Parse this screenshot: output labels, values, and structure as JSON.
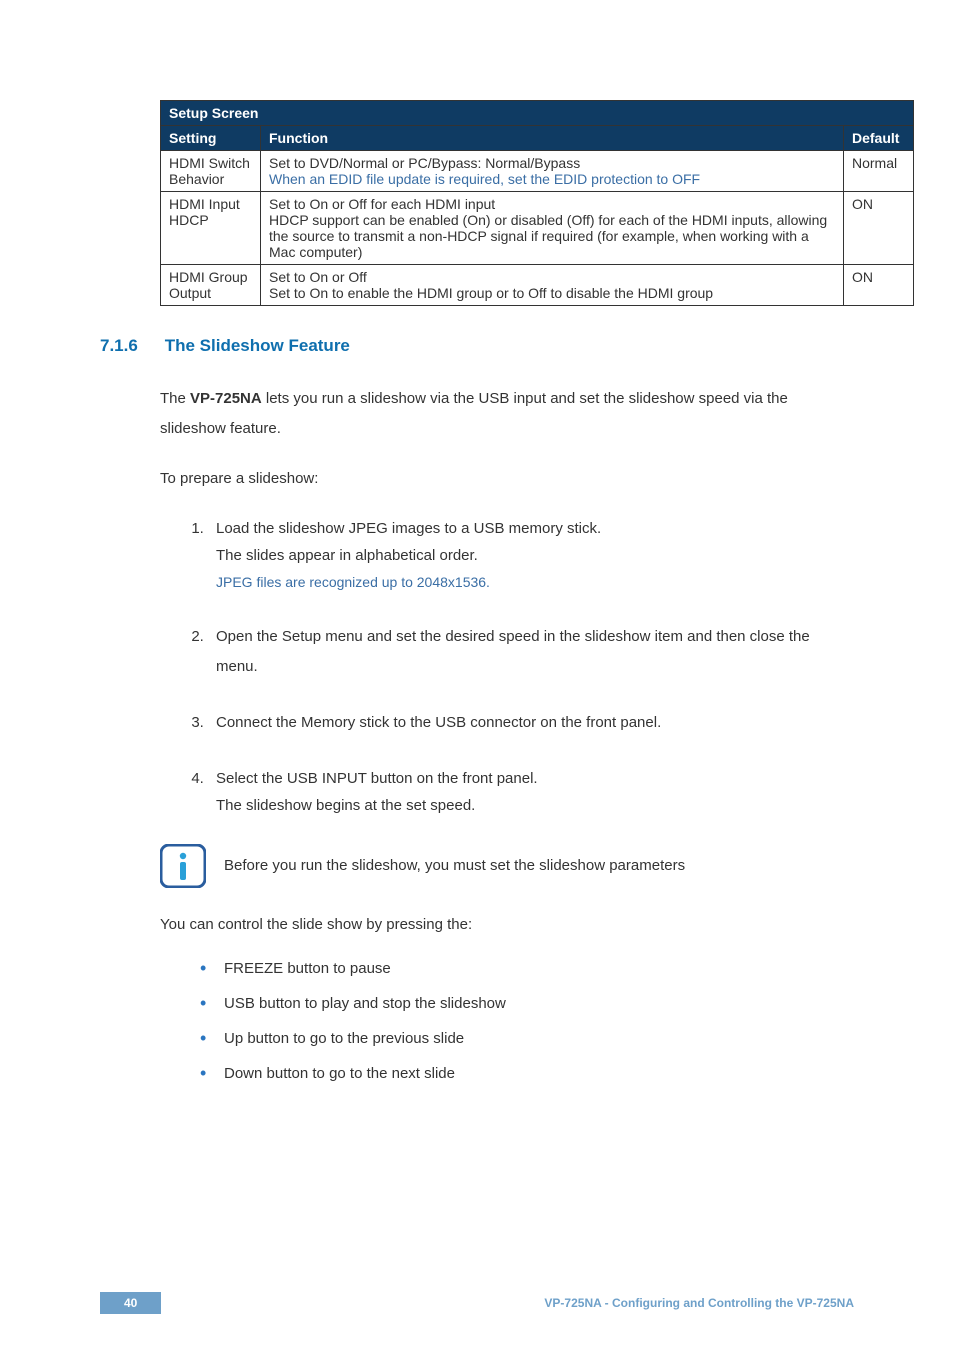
{
  "table": {
    "title": "Setup Screen",
    "headers": {
      "c1": "Setting",
      "c2": "Function",
      "c3": "Default"
    },
    "rows": [
      {
        "setting": "HDMI Switch Behavior",
        "func_line1": "Set to DVD/Normal or PC/Bypass: Normal/Bypass",
        "func_line2": "When an EDID file update is required, set the EDID protection to OFF",
        "default": "Normal"
      },
      {
        "setting": "HDMI Input HDCP",
        "func_line1": "Set to On or Off for each HDMI input",
        "func_line2": "HDCP support can be enabled (On) or disabled (Off) for each of the HDMI inputs, allowing the source to transmit a non-HDCP signal if required (for example, when working with a Mac computer)",
        "default": "ON"
      },
      {
        "setting": "HDMI Group Output",
        "func_line1": "Set to On or Off",
        "func_line2": "Set to On to enable the HDMI group or to Off to disable the HDMI group",
        "default": "ON"
      }
    ]
  },
  "section": {
    "num": "7.1.6",
    "title": "The Slideshow Feature"
  },
  "para1_pre": "The ",
  "para1_bold": "VP-725NA",
  "para1_post": " lets you run a slideshow via the USB input and set the slideshow speed via the slideshow feature.",
  "para2": "To prepare a slideshow:",
  "list": {
    "i1_l1": "Load the slideshow JPEG images to a USB memory stick.",
    "i1_l2": "The slides appear in alphabetical order.",
    "i1_l3": "JPEG files are recognized up to 2048x1536.",
    "i2": "Open the Setup menu and set the desired speed in the slideshow item and then close the menu.",
    "i3": "Connect the Memory stick to the USB connector on the front panel.",
    "i4_l1": "Select the USB INPUT button on the front panel.",
    "i4_l2": "The slideshow begins at the set speed."
  },
  "info_text": "Before you run the slideshow, you must set the slideshow parameters",
  "para3": "You can control the slide show by pressing the:",
  "bullets": {
    "b1": "FREEZE button to pause",
    "b2": "USB button to play and stop the slideshow",
    "b3": "Up button to go to the previous slide",
    "b4": "Down button to go to the next slide"
  },
  "footer": {
    "page": "40",
    "text": "VP-725NA - Configuring and Controlling the VP-725NA"
  }
}
